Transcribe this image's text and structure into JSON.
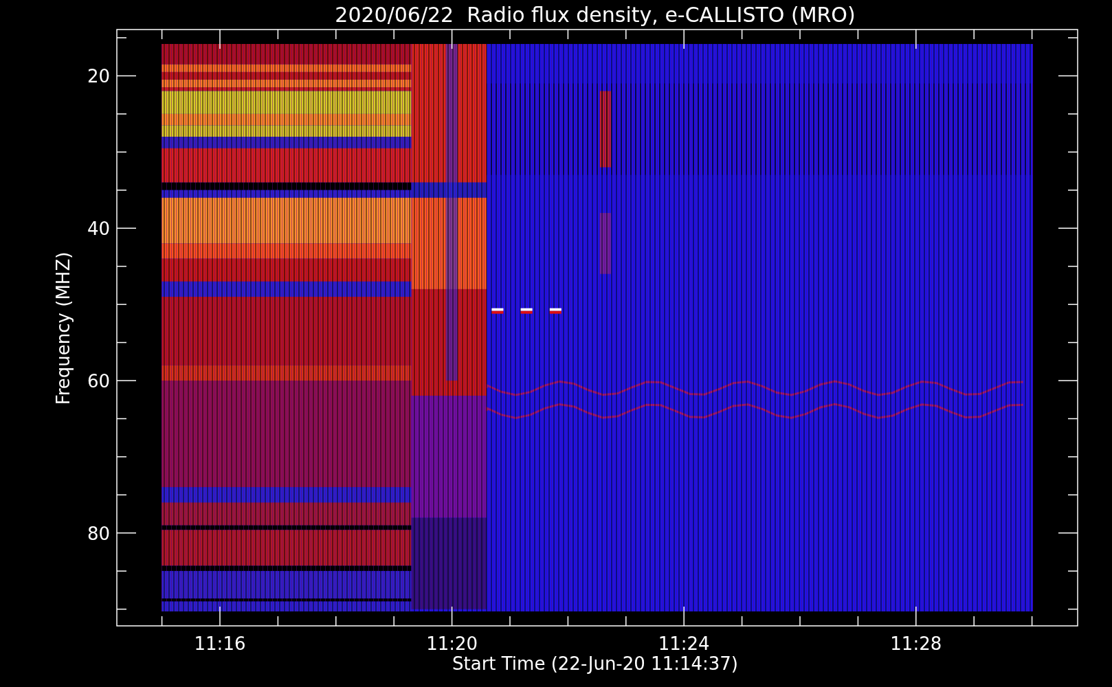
{
  "title": "2020/06/22  Radio flux density, e-CALLISTO (MRO)",
  "y_axis": {
    "label": "Frequency (MHZ)",
    "ticks": [
      "20",
      "40",
      "60",
      "80"
    ]
  },
  "x_axis": {
    "label": "Start Time (22-Jun-20 11:14:37)",
    "ticks": [
      "11:16",
      "11:20",
      "11:24",
      "11:28"
    ]
  }
}
